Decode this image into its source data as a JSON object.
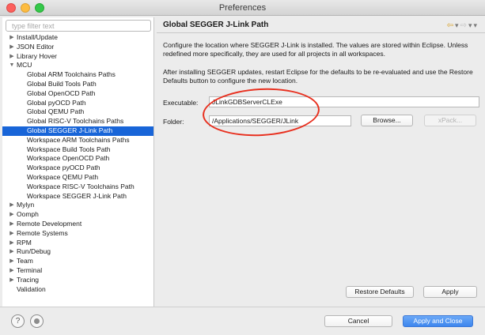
{
  "window": {
    "title": "Preferences"
  },
  "sidebar": {
    "filter_placeholder": "type filter text",
    "items": [
      {
        "label": "Install/Update",
        "arrow": "▶",
        "indent": 0
      },
      {
        "label": "JSON Editor",
        "arrow": "▶",
        "indent": 0
      },
      {
        "label": "Library Hover",
        "arrow": "▶",
        "indent": 0
      },
      {
        "label": "MCU",
        "arrow": "▼",
        "indent": 0
      },
      {
        "label": "Global ARM Toolchains Paths",
        "arrow": "",
        "indent": 1
      },
      {
        "label": "Global Build Tools Path",
        "arrow": "",
        "indent": 1
      },
      {
        "label": "Global OpenOCD Path",
        "arrow": "",
        "indent": 1
      },
      {
        "label": "Global pyOCD Path",
        "arrow": "",
        "indent": 1
      },
      {
        "label": "Global QEMU Path",
        "arrow": "",
        "indent": 1
      },
      {
        "label": "Global RISC-V Toolchains Paths",
        "arrow": "",
        "indent": 1
      },
      {
        "label": "Global SEGGER J-Link Path",
        "arrow": "",
        "indent": 1,
        "selected": true
      },
      {
        "label": "Workspace ARM Toolchains Paths",
        "arrow": "",
        "indent": 1
      },
      {
        "label": "Workspace Build Tools Path",
        "arrow": "",
        "indent": 1
      },
      {
        "label": "Workspace OpenOCD Path",
        "arrow": "",
        "indent": 1
      },
      {
        "label": "Workspace pyOCD Path",
        "arrow": "",
        "indent": 1
      },
      {
        "label": "Workspace QEMU Path",
        "arrow": "",
        "indent": 1
      },
      {
        "label": "Workspace RISC-V Toolchains Path",
        "arrow": "",
        "indent": 1
      },
      {
        "label": "Workspace SEGGER J-Link Path",
        "arrow": "",
        "indent": 1
      },
      {
        "label": "Mylyn",
        "arrow": "▶",
        "indent": 0
      },
      {
        "label": "Oomph",
        "arrow": "▶",
        "indent": 0
      },
      {
        "label": "Remote Development",
        "arrow": "▶",
        "indent": 0
      },
      {
        "label": "Remote Systems",
        "arrow": "▶",
        "indent": 0
      },
      {
        "label": "RPM",
        "arrow": "▶",
        "indent": 0
      },
      {
        "label": "Run/Debug",
        "arrow": "▶",
        "indent": 0
      },
      {
        "label": "Team",
        "arrow": "▶",
        "indent": 0
      },
      {
        "label": "Terminal",
        "arrow": "▶",
        "indent": 0
      },
      {
        "label": "Tracing",
        "arrow": "▶",
        "indent": 0
      },
      {
        "label": "Validation",
        "arrow": "",
        "indent": 0
      }
    ]
  },
  "page": {
    "title": "Global SEGGER J-Link Path",
    "description1": "Configure the location where SEGGER J-Link is installed. The values are stored within Eclipse. Unless redefined more specifically, they are used for all projects in all workspaces.",
    "description2": "After installing SEGGER updates, restart Eclipse for the defaults to be re-evaluated and use the Restore Defaults button to configure the new location.",
    "executable_label": "Executable:",
    "executable_value": "JLinkGDBServerCLExe",
    "folder_label": "Folder:",
    "folder_value": "/Applications/SEGGER/JLink",
    "browse_label": "Browse...",
    "xpack_label": "xPack...",
    "restore_defaults_label": "Restore Defaults",
    "apply_label": "Apply"
  },
  "footer": {
    "help_glyph": "?",
    "cancel_label": "Cancel",
    "apply_close_label": "Apply and Close"
  },
  "colors": {
    "selection": "#1865d8",
    "annotation": "#e8301f",
    "primary_button": "#3d86ee"
  },
  "icons": {
    "back": "back-arrow-icon",
    "forward": "forward-arrow-icon",
    "menu": "view-menu-icon",
    "help": "help-icon",
    "import_export": "import-export-icon"
  }
}
